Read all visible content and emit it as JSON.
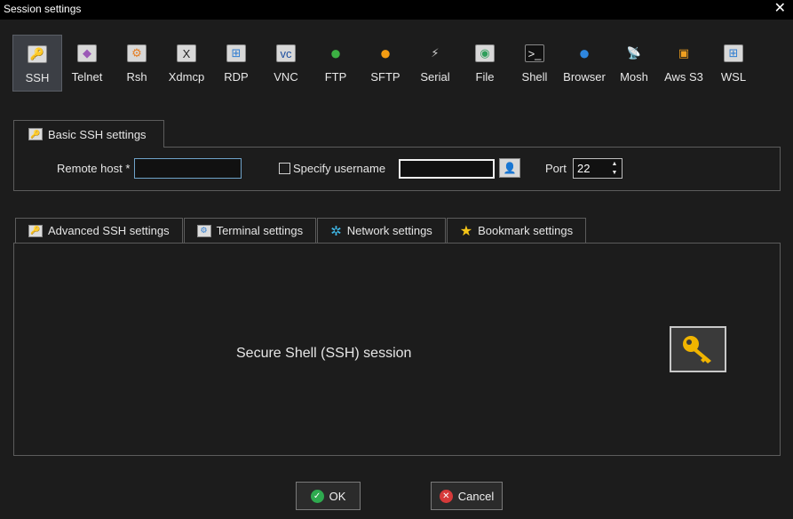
{
  "window": {
    "title": "Session settings",
    "close_glyph": "✕"
  },
  "protocols": [
    {
      "label": "SSH",
      "icon": "ssh-key-icon",
      "glyph": "🔑",
      "bg": "#dcdcdc",
      "active": true
    },
    {
      "label": "Telnet",
      "icon": "telnet-icon",
      "glyph": "◆",
      "bg": "#d8d8d8",
      "color": "#9b59b6"
    },
    {
      "label": "Rsh",
      "icon": "rsh-icon",
      "glyph": "⚙",
      "bg": "#d8d8d8",
      "color": "#e67e22"
    },
    {
      "label": "Xdmcp",
      "icon": "xdmcp-icon",
      "glyph": "X",
      "bg": "#d8d8d8",
      "color": "#222"
    },
    {
      "label": "RDP",
      "icon": "rdp-icon",
      "glyph": "⊞",
      "bg": "#d8d8d8",
      "color": "#2f7dd1"
    },
    {
      "label": "VNC",
      "icon": "vnc-icon",
      "glyph": "vc",
      "bg": "#d8d8d8",
      "color": "#1d4fa0"
    },
    {
      "label": "FTP",
      "icon": "ftp-globe-icon",
      "glyph": "●",
      "bg": "transparent",
      "color": "#3cb043"
    },
    {
      "label": "SFTP",
      "icon": "sftp-globe-icon",
      "glyph": "●",
      "bg": "transparent",
      "color": "#f39c12"
    },
    {
      "label": "Serial",
      "icon": "serial-plug-icon",
      "glyph": "⚡",
      "bg": "transparent",
      "color": "#cfcfcf"
    },
    {
      "label": "File",
      "icon": "file-browser-icon",
      "glyph": "◉",
      "bg": "#d8d8d8",
      "color": "#2e9e5b"
    },
    {
      "label": "Shell",
      "icon": "shell-terminal-icon",
      "glyph": ">_",
      "bg": "#111",
      "color": "#eee"
    },
    {
      "label": "Browser",
      "icon": "browser-globe-icon",
      "glyph": "●",
      "bg": "transparent",
      "color": "#2e86de"
    },
    {
      "label": "Mosh",
      "icon": "mosh-antenna-icon",
      "glyph": "📡",
      "bg": "transparent",
      "color": "#3498db"
    },
    {
      "label": "Aws S3",
      "icon": "aws-s3-cubes-icon",
      "glyph": "▣",
      "bg": "transparent",
      "color": "#f0a020"
    },
    {
      "label": "WSL",
      "icon": "wsl-windows-icon",
      "glyph": "⊞",
      "bg": "#d8d8d8",
      "color": "#2f7dd1"
    }
  ],
  "basic": {
    "tab_label": "Basic SSH settings",
    "remote_host_label": "Remote host *",
    "remote_host_value": "",
    "specify_username_label": "Specify username",
    "username_value": "",
    "port_label": "Port",
    "port_value": "22"
  },
  "tabs": [
    {
      "label": "Advanced SSH settings",
      "icon": "key-icon"
    },
    {
      "label": "Terminal settings",
      "icon": "terminal-settings-icon"
    },
    {
      "label": "Network settings",
      "icon": "network-icon"
    },
    {
      "label": "Bookmark settings",
      "icon": "star-icon"
    }
  ],
  "main": {
    "description": "Secure Shell (SSH) session"
  },
  "buttons": {
    "ok_label": "OK",
    "cancel_label": "Cancel"
  },
  "colors": {
    "background": "#1c1c1c",
    "ok_green": "#2eaa4f",
    "cancel_red": "#d63a3a",
    "key_gold": "#f0b400"
  }
}
